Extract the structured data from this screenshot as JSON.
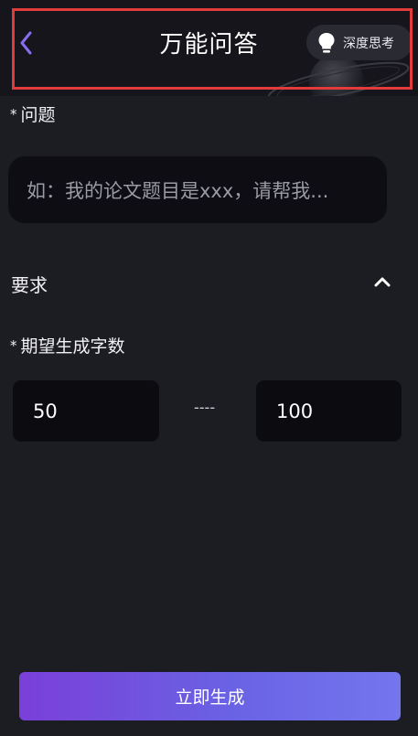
{
  "header": {
    "title": "万能问答",
    "deep_think_label": "深度思考"
  },
  "question": {
    "label": "问题",
    "required_mark": "*",
    "placeholder": "如：我的论文题目是xxx，请帮我..."
  },
  "requirements": {
    "label": "要求",
    "expanded": true
  },
  "word_count": {
    "label": "期望生成字数",
    "required_mark": "*",
    "min": "50",
    "separator": "----",
    "max": "100"
  },
  "generate_button": {
    "label": "立即生成"
  },
  "colors": {
    "background": "#1c1c23",
    "input_background": "#0d0d13",
    "accent_start": "#7a3fd8",
    "accent_end": "#7476ee",
    "back_icon": "#8a6cf0",
    "highlight_border": "#e23b3b"
  },
  "icons": {
    "back": "chevron-left-icon",
    "deep_think": "lightbulb-icon",
    "collapse": "chevron-up-icon"
  }
}
